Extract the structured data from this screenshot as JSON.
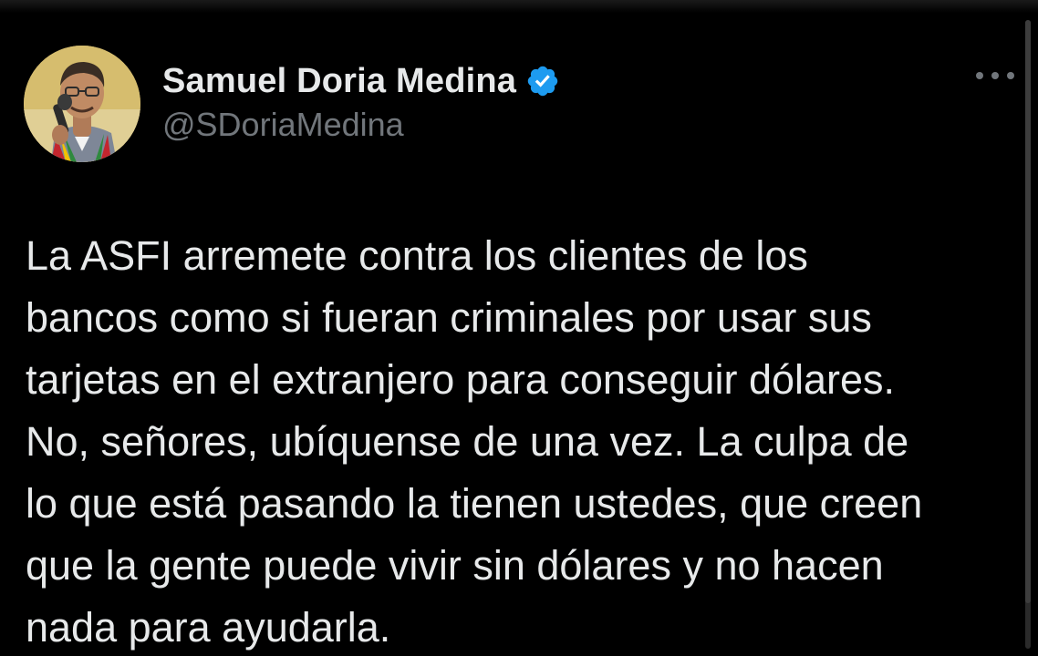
{
  "author": {
    "display_name": "Samuel Doria Medina",
    "handle": "@SDoriaMedina",
    "verified_icon": "verified-badge-icon",
    "verified_color": "#1d9bf0"
  },
  "menu": {
    "icon": "more-options-icon"
  },
  "tweet": {
    "lines": [
      "La ASFI arremete contra los clientes de los",
      "bancos como si fueran criminales por usar sus",
      "tarjetas en el extranjero para conseguir dólares.",
      "No, señores, ubíquense de una vez. La culpa de",
      "lo que está pasando la tienen ustedes, que creen",
      "que la gente puede vivir sin dólares y no hacen",
      "nada para ayudarla."
    ]
  },
  "theme": {
    "background": "#000000",
    "primary_text": "#e7e9ea",
    "secondary_text": "#71767b"
  }
}
